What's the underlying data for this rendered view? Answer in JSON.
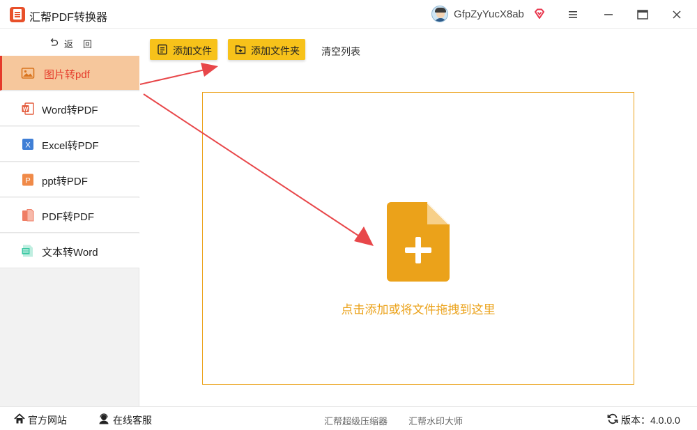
{
  "app": {
    "title": "汇帮PDF转换器"
  },
  "user": {
    "name": "GfpZyYucX8ab"
  },
  "sidebar": {
    "back_label": "返回",
    "items": [
      {
        "label": "图片转pdf",
        "icon": "image-icon",
        "active": true
      },
      {
        "label": "Word转PDF",
        "icon": "word-icon"
      },
      {
        "label": "Excel转PDF",
        "icon": "excel-icon"
      },
      {
        "label": "ppt转PDF",
        "icon": "ppt-icon"
      },
      {
        "label": "PDF转PDF",
        "icon": "pdf-icon"
      },
      {
        "label": "文本转Word",
        "icon": "text-doc-icon"
      }
    ]
  },
  "toolbar": {
    "add_file": "添加文件",
    "add_folder": "添加文件夹",
    "clear_list": "清空列表"
  },
  "dropzone": {
    "text": "点击添加或将文件拖拽到这里"
  },
  "statusbar": {
    "website": "官方网站",
    "support": "在线客服",
    "compressor": "汇帮超级压缩器",
    "watermark": "汇帮水印大师",
    "version": "版本：4.0.0.0"
  },
  "colors": {
    "accent_yellow": "#f7c21a",
    "dropzone_orange": "#eba21a",
    "active_item_bg": "#f6c79c",
    "active_text_red": "#e53a2a",
    "arrow_red": "#e8474a"
  }
}
